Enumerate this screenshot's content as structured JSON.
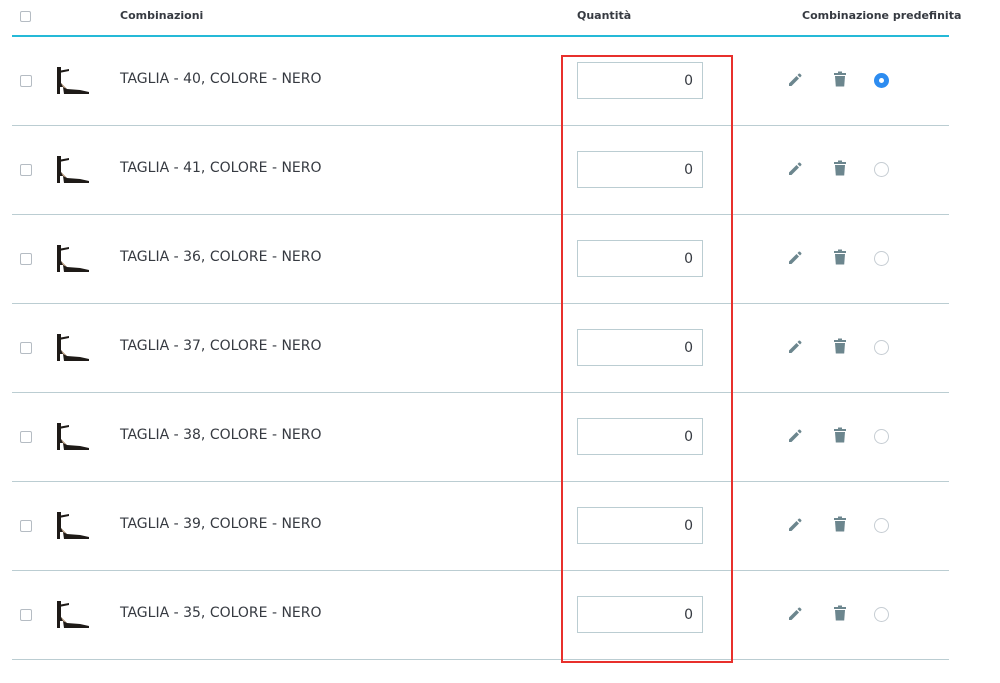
{
  "header": {
    "combinations_label": "Combinazioni",
    "quantity_label": "Quantità",
    "default_label": "Combinazione predefinita"
  },
  "rows": [
    {
      "label": "TAGLIA - 40, COLORE - NERO",
      "quantity": "0",
      "default": true
    },
    {
      "label": "TAGLIA - 41, COLORE - NERO",
      "quantity": "0",
      "default": false
    },
    {
      "label": "TAGLIA - 36, COLORE - NERO",
      "quantity": "0",
      "default": false
    },
    {
      "label": "TAGLIA - 37, COLORE - NERO",
      "quantity": "0",
      "default": false
    },
    {
      "label": "TAGLIA - 38, COLORE - NERO",
      "quantity": "0",
      "default": false
    },
    {
      "label": "TAGLIA - 39, COLORE - NERO",
      "quantity": "0",
      "default": false
    },
    {
      "label": "TAGLIA - 35, COLORE - NERO",
      "quantity": "0",
      "default": false
    }
  ],
  "icons": {
    "thumbnail": "shoe-icon",
    "edit": "pencil-icon",
    "delete": "trash-icon"
  },
  "colors": {
    "accent": "#25b9d7",
    "radio_selected": "#2d8cf0",
    "highlight": "#e8302c",
    "icon": "#6c868e"
  }
}
